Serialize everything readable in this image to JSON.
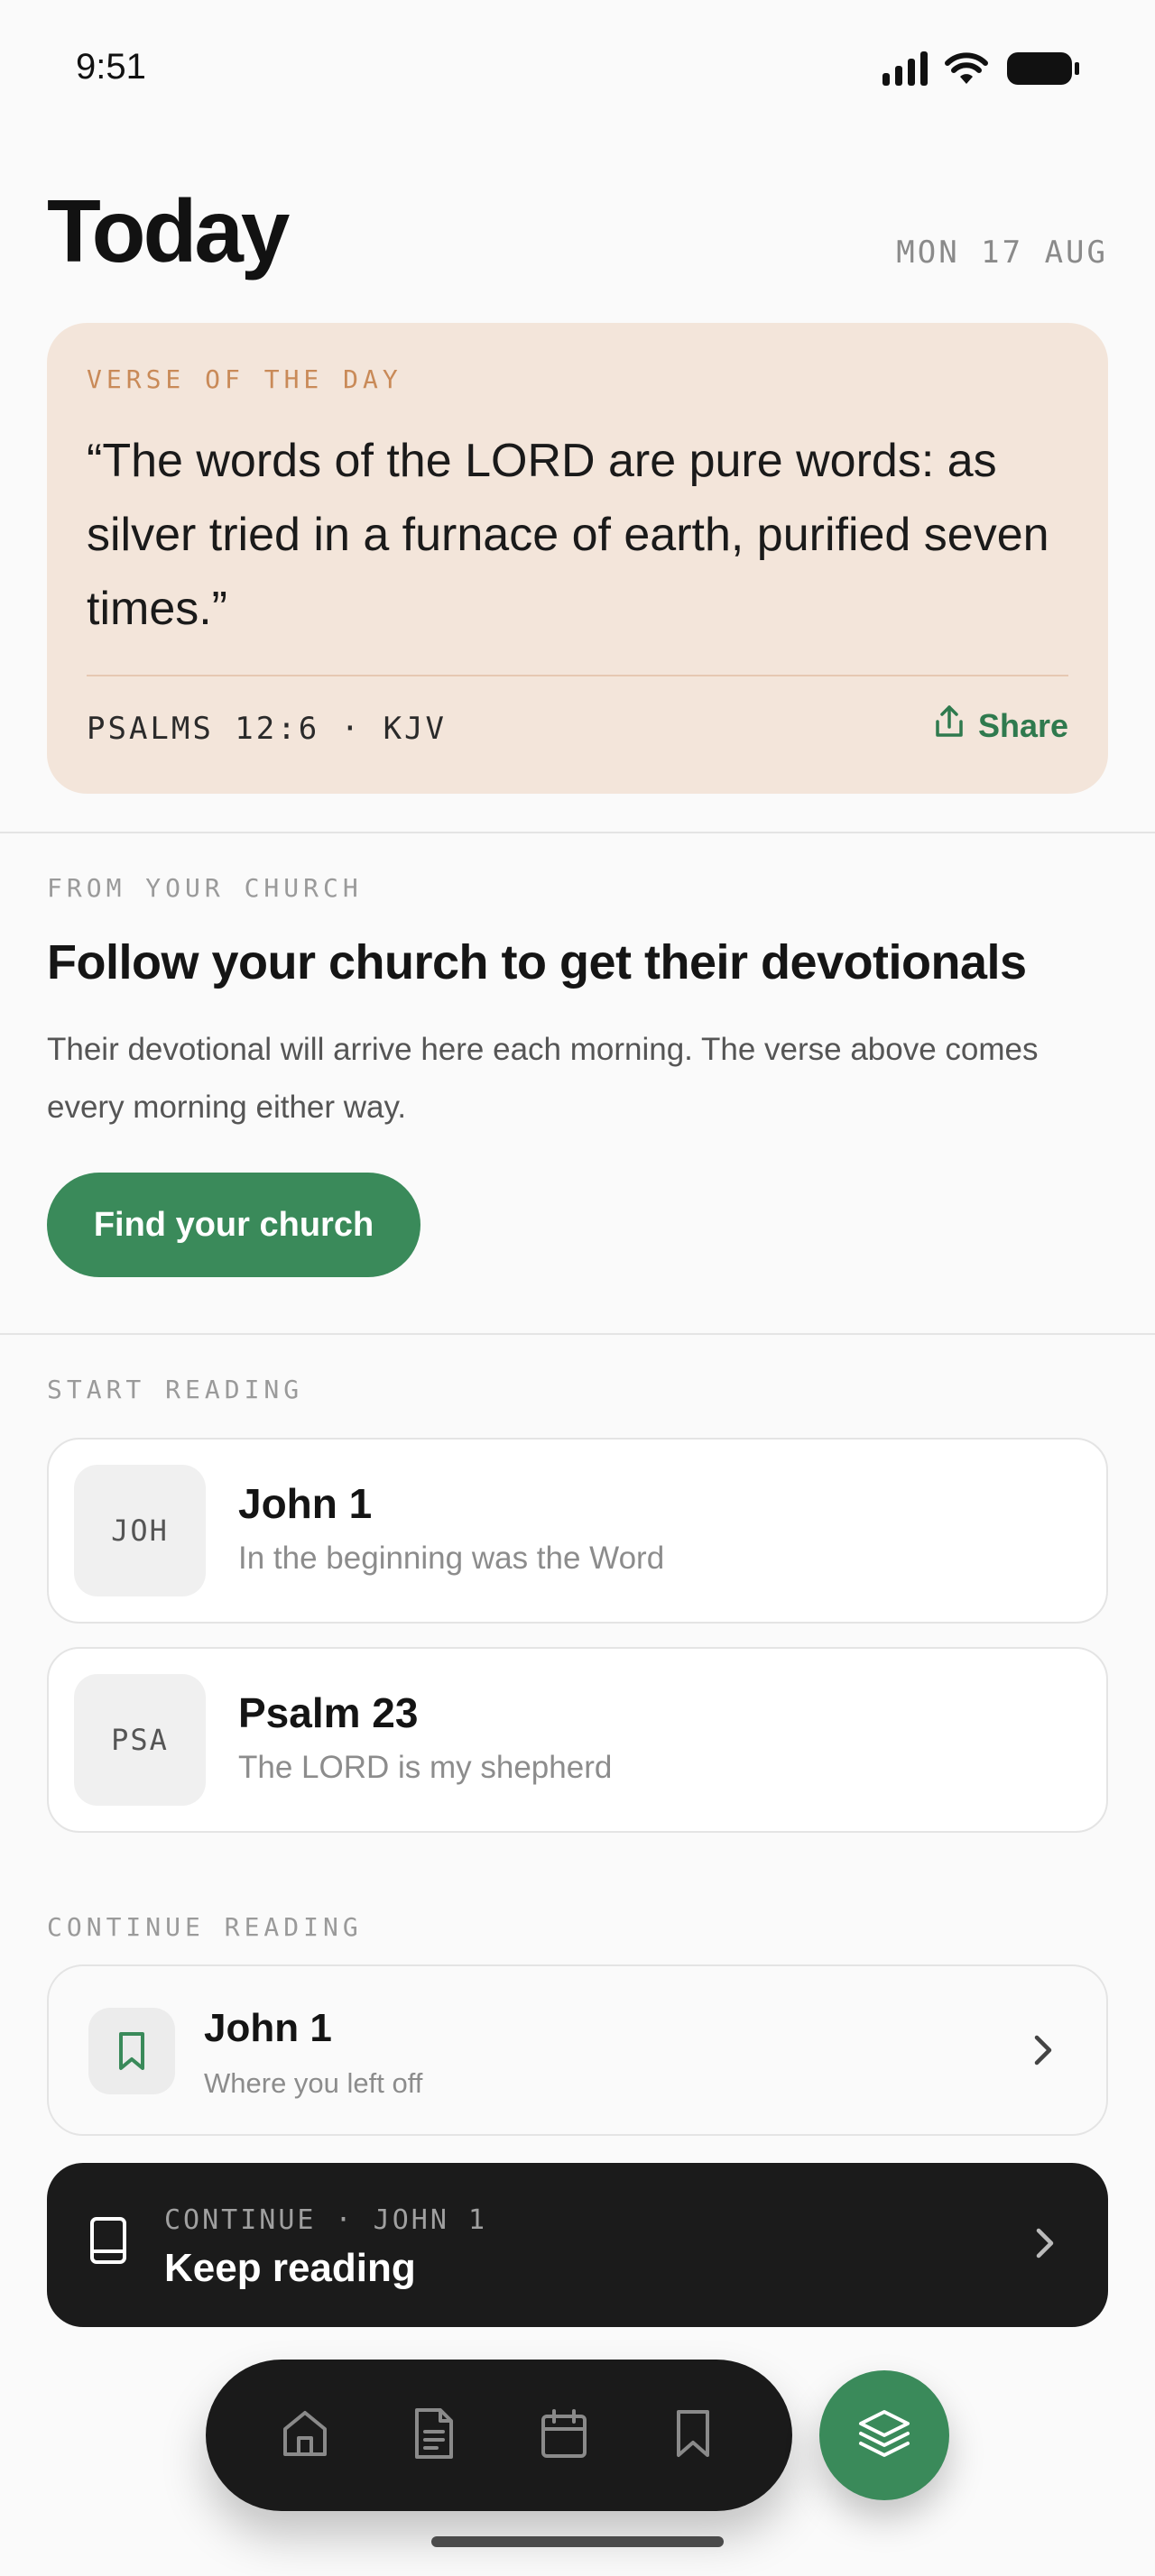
{
  "status_bar": {
    "time": "9:51"
  },
  "header": {
    "title": "Today",
    "date": "MON 17 AUG"
  },
  "verse_card": {
    "eyebrow": "VERSE OF THE DAY",
    "text": "“The words of the LORD are pure words: as silver tried in a furnace of earth, purified seven times.”",
    "reference": "PSALMS 12:6 · KJV",
    "share_label": "Share"
  },
  "church_section": {
    "eyebrow": "FROM YOUR CHURCH",
    "title": "Follow your church to get their devotionals",
    "description": "Their devotional will arrive here each morning. The verse above comes every morning either way.",
    "button_label": "Find your church"
  },
  "start_reading": {
    "eyebrow": "START READING",
    "items": [
      {
        "abbr": "JOH",
        "title": "John 1",
        "subtitle": "In the beginning was the Word"
      },
      {
        "abbr": "PSA",
        "title": "Psalm 23",
        "subtitle": "The LORD is my shepherd"
      }
    ]
  },
  "continue_reading": {
    "eyebrow": "CONTINUE READING",
    "title": "John 1",
    "subtitle": "Where you left off"
  },
  "keep_reading_bar": {
    "eyebrow": "CONTINUE · JOHN 1",
    "title": "Keep reading"
  },
  "tab_bar": {
    "icons": [
      "home-icon",
      "document-icon",
      "calendar-icon",
      "bookmark-icon"
    ],
    "fab_icon": "layers-icon"
  },
  "colors": {
    "accent_green": "#3a8a5a",
    "verse_card_bg": "#f3e5da",
    "verse_eyebrow": "#c98a58",
    "dark_bar": "#1b1b1b"
  }
}
